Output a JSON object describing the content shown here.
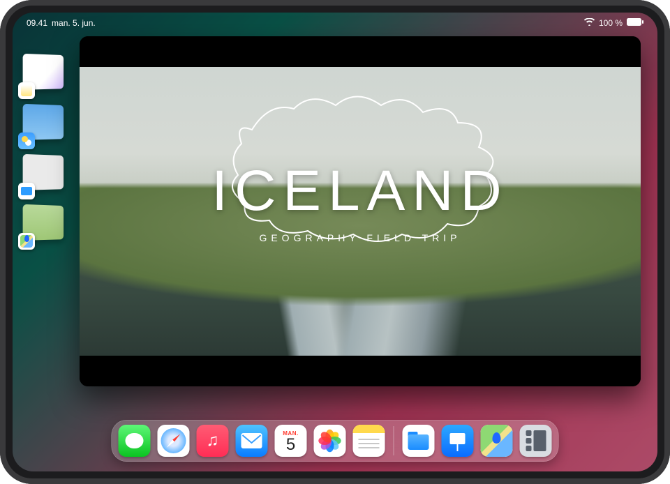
{
  "statusbar": {
    "time": "09.41",
    "date": "man. 5. jun.",
    "battery_text": "100 %"
  },
  "stage_manager": {
    "items": [
      {
        "app": "Notes"
      },
      {
        "app": "Weather"
      },
      {
        "app": "Files"
      },
      {
        "app": "Maps"
      }
    ]
  },
  "main_window": {
    "slide_title": "ICELAND",
    "slide_subtitle": "GEOGRAPHY FIELD TRIP"
  },
  "dock": {
    "calendar_weekday": "Man.",
    "calendar_day": "5",
    "apps_main": [
      "Messages",
      "Safari",
      "Music",
      "Mail",
      "Calendar",
      "Photos",
      "Notes"
    ],
    "apps_recent": [
      "Files",
      "Keynote",
      "Maps",
      "Stage Manager"
    ]
  }
}
